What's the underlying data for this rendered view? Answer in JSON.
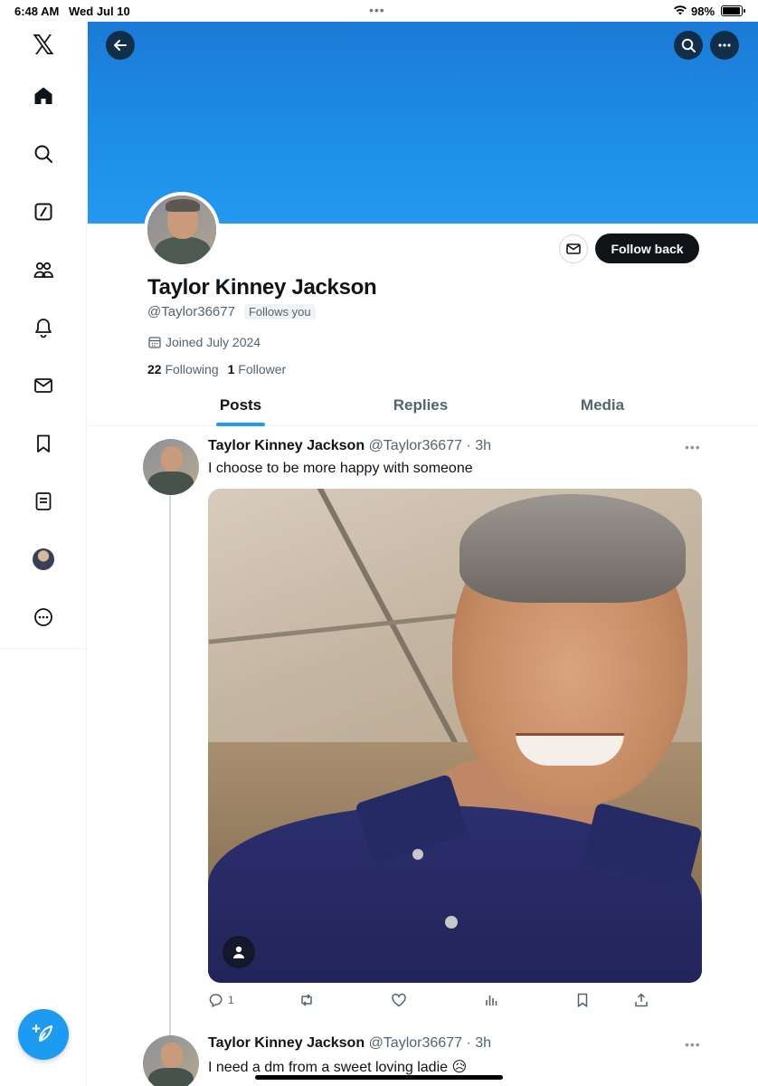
{
  "status_bar": {
    "time": "6:48 AM",
    "date": "Wed Jul 10",
    "battery": "98%",
    "dots": "•••"
  },
  "sidebar": {
    "logo": "𝕏",
    "items": [
      {
        "icon": "home-icon"
      },
      {
        "icon": "search-icon"
      },
      {
        "icon": "grok-icon"
      },
      {
        "icon": "communities-icon"
      },
      {
        "icon": "notifications-icon"
      },
      {
        "icon": "messages-icon"
      },
      {
        "icon": "bookmarks-icon"
      },
      {
        "icon": "lists-icon"
      },
      {
        "icon": "profile-avatar-icon"
      },
      {
        "icon": "more-icon"
      }
    ],
    "compose_icon": "compose-icon"
  },
  "profile": {
    "display_name": "Taylor Kinney Jackson",
    "handle": "@Taylor36677",
    "follows_you": "Follows you",
    "joined": "Joined July 2024",
    "following_count": "22",
    "following_label": "Following",
    "followers_count": "1",
    "followers_label": "Follower",
    "follow_button": "Follow back",
    "banner_color": "#1d8de6"
  },
  "tabs": [
    {
      "label": "Posts",
      "active": true
    },
    {
      "label": "Replies",
      "active": false
    },
    {
      "label": "Media",
      "active": false
    }
  ],
  "posts": [
    {
      "name": "Taylor Kinney Jackson",
      "meta": "@Taylor36677 · 3h",
      "text": "I choose to be more happy with someone",
      "reply_count": "1",
      "has_media": true
    },
    {
      "name": "Taylor Kinney Jackson",
      "meta": "@Taylor36677 · 3h",
      "text": "I need a dm from a sweet loving ladie 😥"
    }
  ],
  "colors": {
    "accent": "#1d9bf0",
    "text": "#0f1419",
    "muted": "#536471"
  }
}
